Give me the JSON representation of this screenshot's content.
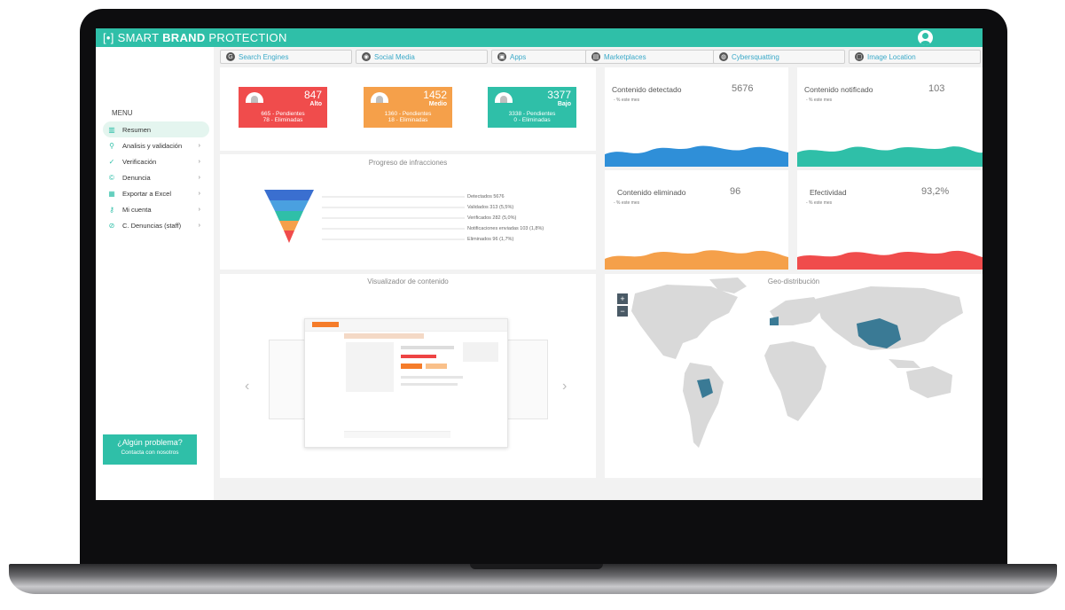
{
  "app": {
    "brand_prefix": "[•]",
    "brand_smart": "SMART ",
    "brand_bold": "BRAND",
    "brand_rest": " PROTECTION"
  },
  "tabs": [
    {
      "label": "Search Engines",
      "icon": "google-icon"
    },
    {
      "label": "Social Media",
      "icon": "social-icon"
    },
    {
      "label": "Apps",
      "icon": "apps-icon"
    },
    {
      "label": "Marketplaces",
      "icon": "cart-icon"
    },
    {
      "label": "Cybersquatting",
      "icon": "globe-icon"
    },
    {
      "label": "Image Location",
      "icon": "image-icon"
    }
  ],
  "sidebar": {
    "menu_title": "MENU",
    "items": [
      {
        "label": "Resumen",
        "icon": "chart-icon"
      },
      {
        "label": "Analisis y validación",
        "icon": "search-icon"
      },
      {
        "label": "Verificación",
        "icon": "check-icon"
      },
      {
        "label": "Denuncia",
        "icon": "copyright-icon"
      },
      {
        "label": "Exportar a Excel",
        "icon": "table-icon"
      },
      {
        "label": "Mi cuenta",
        "icon": "key-icon"
      },
      {
        "label": "C. Denuncias (staff)",
        "icon": "ban-icon"
      }
    ],
    "help_title": "¿Algún problema?",
    "help_sub": "Contacta con nosotros"
  },
  "severity": [
    {
      "num": "847",
      "level": "Alto",
      "line1": "665 - Pendientes",
      "line2": "78 - Eliminadas",
      "color": "#f04c4c"
    },
    {
      "num": "1452",
      "level": "Medio",
      "line1": "1360 - Pendientes",
      "line2": "18 - Eliminadas",
      "color": "#f5a04a"
    },
    {
      "num": "3377",
      "level": "Bajo",
      "line1": "3338 - Pendientes",
      "line2": "0 - Eliminadas",
      "color": "#2fbfa8"
    }
  ],
  "progress": {
    "title": "Progreso de infracciones",
    "stages": [
      "Detectados 5676",
      "Validados 313 (5,5%)",
      "Verificados 282 (5,0%)",
      "Notificaciones enviadas 103 (1,8%)",
      "Eliminados 96 (1,7%)"
    ]
  },
  "stats": [
    {
      "label": "Contenido detectado",
      "value": "5676",
      "sub": "- % este mes",
      "color": "#2f8fd8"
    },
    {
      "label": "Contenido notificado",
      "value": "103",
      "sub": "- % este mes",
      "color": "#2fbfa8"
    },
    {
      "label": "Contenido eliminado",
      "value": "96",
      "sub": "- % este mes",
      "color": "#f5a04a"
    },
    {
      "label": "Efectividad",
      "value": "93,2%",
      "sub": "- % este mes",
      "color": "#f04c4c"
    }
  ],
  "viewer": {
    "title": "Visualizador de contenido"
  },
  "geo": {
    "title": "Geo-distribución",
    "zoom_in": "+",
    "zoom_out": "−"
  }
}
